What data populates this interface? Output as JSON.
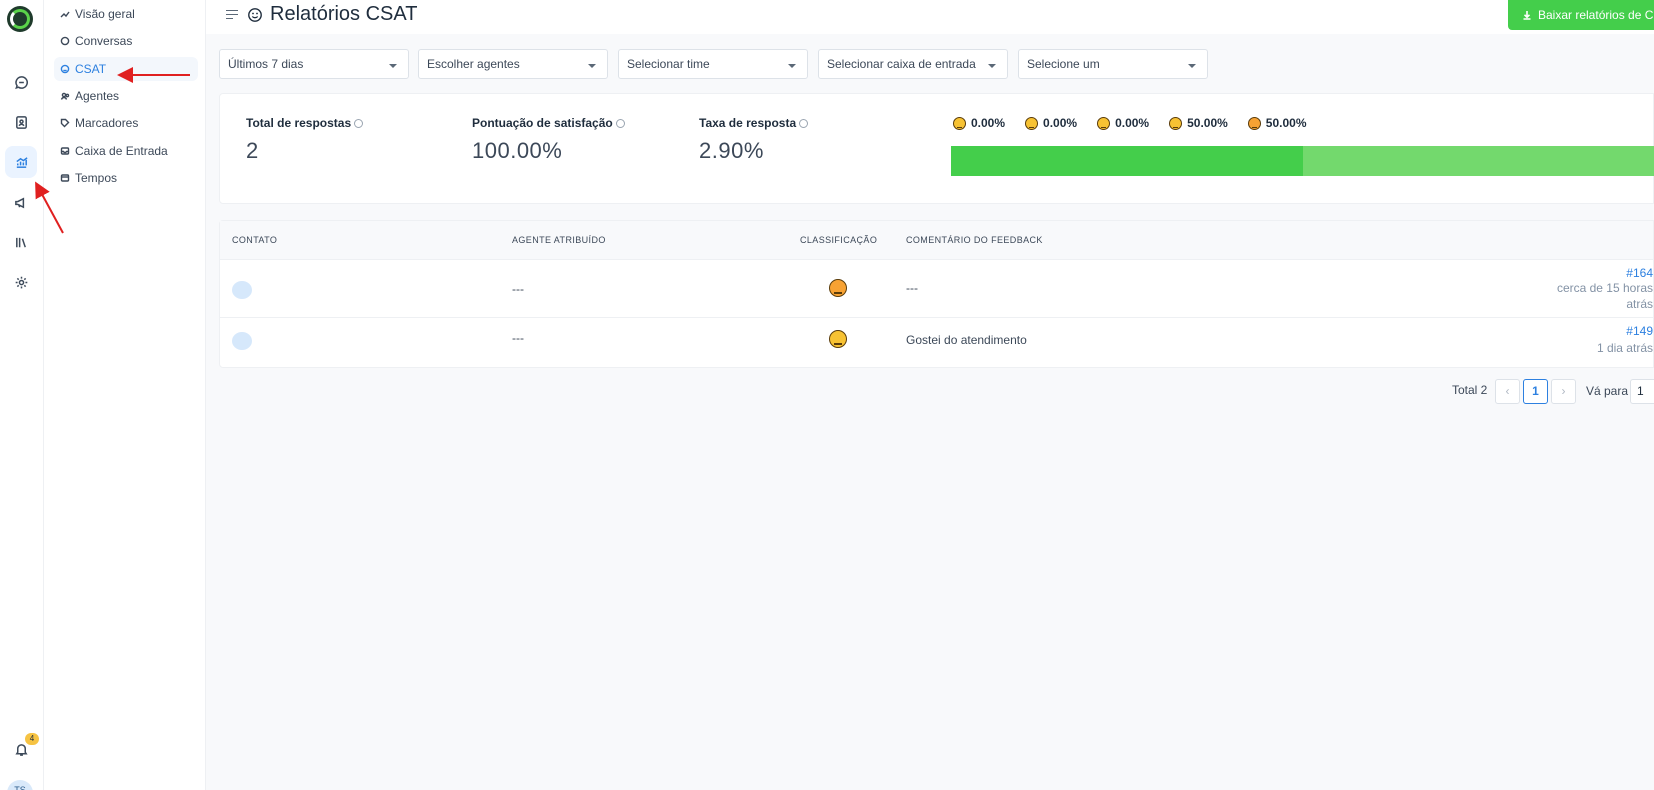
{
  "sidebar": {
    "items": [
      {
        "label": "Visão geral",
        "icon": "trend-icon"
      },
      {
        "label": "Conversas",
        "icon": "chat-icon"
      },
      {
        "label": "CSAT",
        "icon": "smile-icon"
      },
      {
        "label": "Agentes",
        "icon": "users-icon"
      },
      {
        "label": "Marcadores",
        "icon": "tag-icon"
      },
      {
        "label": "Caixa de Entrada",
        "icon": "inbox-icon"
      },
      {
        "label": "Tempos",
        "icon": "clock-icon"
      }
    ],
    "active": "CSAT"
  },
  "rail": {
    "notification_count": "4",
    "avatar_initials": "TS"
  },
  "header": {
    "title": "Relatórios CSAT",
    "download_label": "Baixar relatórios de C"
  },
  "filters": [
    {
      "value": "Últimos 7 dias"
    },
    {
      "value": "Escolher agentes"
    },
    {
      "value": "Selecionar time"
    },
    {
      "value": "Selecionar caixa de entrada"
    },
    {
      "value": "Selecione um"
    }
  ],
  "metrics": {
    "total": {
      "label": "Total de respostas",
      "value": "2"
    },
    "satisfaction": {
      "label": "Pontuação de satisfação",
      "value": "100.00%"
    },
    "response_rate": {
      "label": "Taxa de resposta",
      "value": "2.90%"
    }
  },
  "ratings": [
    {
      "pct_label": "0.00%",
      "pct": 0,
      "icon": "frown-emoji-icon",
      "color": "#2f9e37"
    },
    {
      "pct_label": "0.00%",
      "pct": 0,
      "icon": "sad-emoji-icon",
      "color": "#36b33f"
    },
    {
      "pct_label": "0.00%",
      "pct": 0,
      "icon": "neutral-emoji-icon",
      "color": "#3dc246"
    },
    {
      "pct_label": "50.00%",
      "pct": 50,
      "icon": "smile-emoji-icon",
      "color": "#44ce4b"
    },
    {
      "pct_label": "50.00%",
      "pct": 50,
      "icon": "heart-eyes-emoji-icon",
      "color": "#73d96d"
    }
  ],
  "table": {
    "headers": {
      "contact": "CONTATO",
      "agent": "AGENTE ATRIBUÍDO",
      "rating": "CLASSIFICAÇÃO",
      "comment": "COMENTÁRIO DO FEEDBACK"
    },
    "rows": [
      {
        "agent": "---",
        "rating_icon": "heart-eyes-emoji-icon",
        "comment": "---",
        "conversation": "#164",
        "time_line1": "cerca de 15 horas",
        "time_line2": "atrás"
      },
      {
        "agent": "---",
        "rating_icon": "smile-emoji-icon",
        "comment": "Gostei do atendimento",
        "conversation": "#149",
        "time_line1": "1 dia atrás",
        "time_line2": ""
      }
    ]
  },
  "pagination": {
    "total_label": "Total 2",
    "current_page": "1",
    "prev": "‹",
    "next": "›",
    "goto_label": "Vá para",
    "goto_value": "1"
  }
}
